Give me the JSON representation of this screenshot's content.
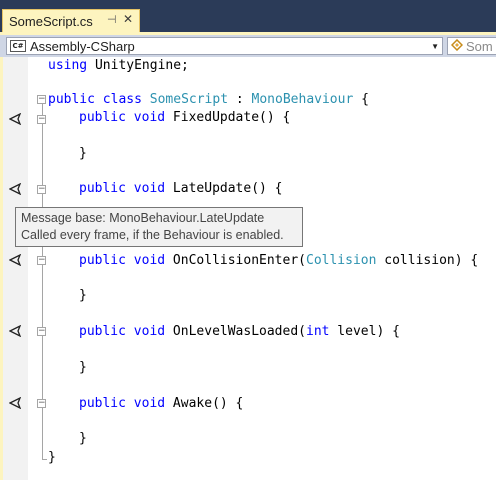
{
  "tab": {
    "title": "SomeScript.cs",
    "pin": "⊣",
    "close": "✕"
  },
  "navbar": {
    "project": "Assembly-CSharp",
    "project_icon": "C#",
    "class_label": "Som"
  },
  "code": {
    "line1": {
      "kw": "using",
      "rest": " UnityEngine;"
    },
    "line2": {
      "k1": "public",
      "k2": "class",
      "name": "SomeScript",
      "colon": " : ",
      "base": "MonoBehaviour",
      "brace": " {"
    },
    "fixed": {
      "k1": "public",
      "k2": "void",
      "name": " FixedUpdate() {"
    },
    "late": {
      "k1": "public",
      "k2": "void",
      "name": " LateUpdate() {"
    },
    "collision": {
      "k1": "public",
      "k2": "void",
      "name": " OnCollisionEnter(",
      "type": "Collision",
      "rest": " collision) {"
    },
    "level": {
      "k1": "public",
      "k2": "void",
      "name": " OnLevelWasLoaded(",
      "type": "int",
      "rest": " level) {"
    },
    "awake": {
      "k1": "public",
      "k2": "void",
      "name": " Awake() {"
    },
    "close_brace": "}"
  },
  "tooltip": {
    "line1": "Message base: MonoBehaviour.LateUpdate",
    "line2": "Called every frame, if the Behaviour is enabled."
  },
  "colors": {
    "keyword": "#0000ff",
    "type": "#2b91af",
    "tab_bg": "#fdf4bf",
    "chrome_bg": "#293955"
  },
  "icons": [
    "unity-message-icon",
    "fold-icon",
    "csharp-file-icon",
    "class-icon",
    "pin-icon",
    "close-icon",
    "dropdown-arrow-icon"
  ]
}
